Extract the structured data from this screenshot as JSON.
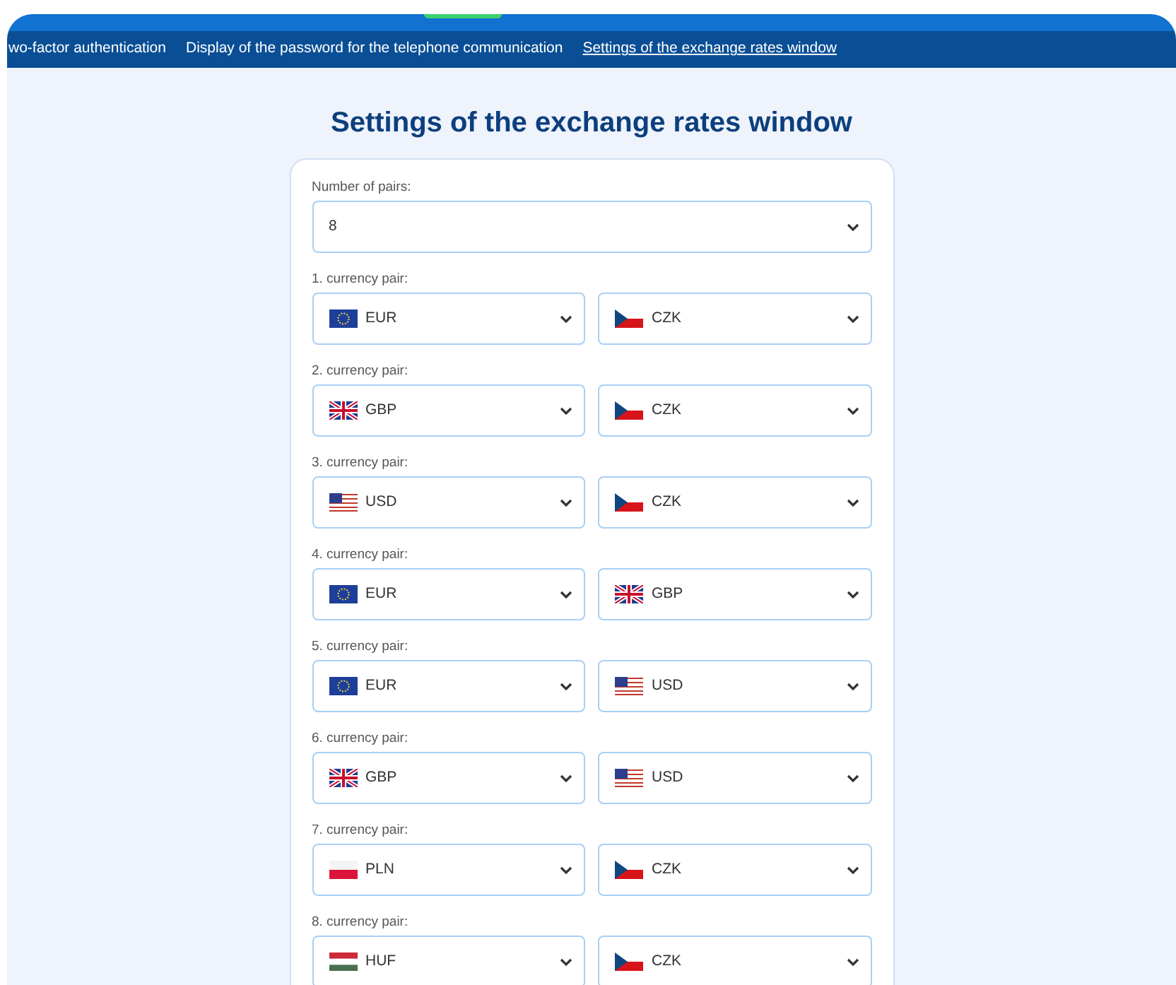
{
  "nav": {
    "items": [
      {
        "label": "wo-factor authentication",
        "selected": false
      },
      {
        "label": "Display of the password for the telephone communication",
        "selected": false
      },
      {
        "label": "Settings of the exchange rates window",
        "selected": true
      }
    ]
  },
  "title": "Settings of the exchange rates window",
  "pairs_count": {
    "label": "Number of pairs:",
    "value": "8"
  },
  "pairs": [
    {
      "label": "1. currency pair:",
      "from": {
        "code": "EUR",
        "kind": "eu"
      },
      "to": {
        "code": "CZK",
        "kind": "cz"
      }
    },
    {
      "label": "2. currency pair:",
      "from": {
        "code": "GBP",
        "kind": "gb"
      },
      "to": {
        "code": "CZK",
        "kind": "cz"
      }
    },
    {
      "label": "3. currency pair:",
      "from": {
        "code": "USD",
        "kind": "us"
      },
      "to": {
        "code": "CZK",
        "kind": "cz"
      }
    },
    {
      "label": "4. currency pair:",
      "from": {
        "code": "EUR",
        "kind": "eu"
      },
      "to": {
        "code": "GBP",
        "kind": "gb"
      }
    },
    {
      "label": "5. currency pair:",
      "from": {
        "code": "EUR",
        "kind": "eu"
      },
      "to": {
        "code": "USD",
        "kind": "us"
      }
    },
    {
      "label": "6. currency pair:",
      "from": {
        "code": "GBP",
        "kind": "gb"
      },
      "to": {
        "code": "USD",
        "kind": "us"
      }
    },
    {
      "label": "7. currency pair:",
      "from": {
        "code": "PLN",
        "kind": "pl"
      },
      "to": {
        "code": "CZK",
        "kind": "cz"
      }
    },
    {
      "label": "8. currency pair:",
      "from": {
        "code": "HUF",
        "kind": "hu"
      },
      "to": {
        "code": "CZK",
        "kind": "cz"
      }
    }
  ]
}
